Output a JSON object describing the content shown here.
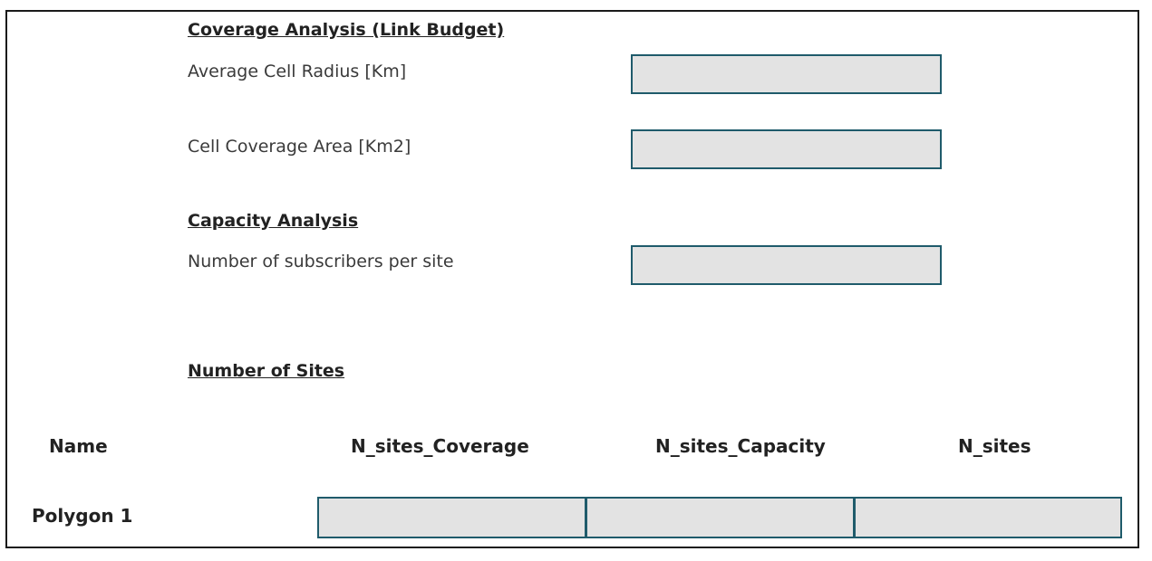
{
  "coverage": {
    "title": "Coverage Analysis (Link Budget)",
    "cell_radius_label": "Average Cell Radius [Km]",
    "cell_radius_value": "",
    "cell_area_label": "Cell Coverage Area [Km2]",
    "cell_area_value": ""
  },
  "capacity": {
    "title": "Capacity Analysis",
    "subscribers_label": "Number of subscribers per site",
    "subscribers_value": ""
  },
  "sites": {
    "title": "Number of Sites",
    "columns": [
      "Name",
      "N_sites_Coverage",
      "N_sites_Capacity",
      "N_sites"
    ],
    "rows": [
      {
        "name": "Polygon 1",
        "n_sites_coverage": "",
        "n_sites_capacity": "",
        "n_sites": ""
      }
    ]
  },
  "colors": {
    "field_background": "#e3e3e3",
    "field_border": "#1f5b6b"
  }
}
